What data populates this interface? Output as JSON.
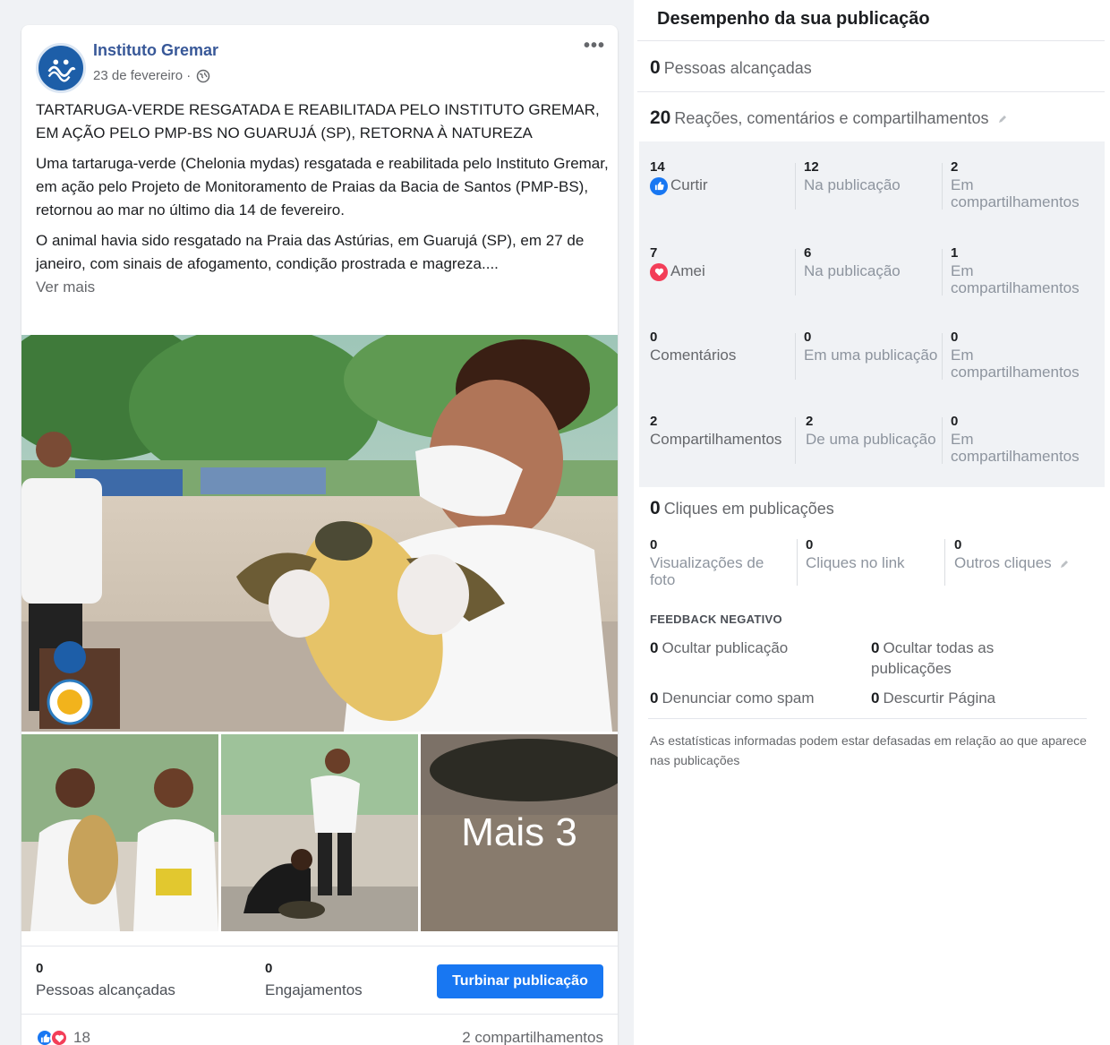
{
  "post": {
    "page_name": "Instituto Gremar",
    "date": "23 de fevereiro ·",
    "more": "•••",
    "title": "TARTARUGA-VERDE RESGATADA E REABILITADA PELO INSTITUTO GREMAR, EM AÇÃO PELO PMP-BS NO GUARUJÁ (SP), RETORNA À NATUREZA",
    "paragraph1": "Uma tartaruga-verde (Chelonia mydas) resgatada e reabilitada pelo Instituto Gremar, em ação pelo Projeto de Monitoramento de Praias da Bacia de Santos (PMP-BS), retornou ao mar no último dia 14 de fevereiro.",
    "paragraph2": "O animal havia sido resgatado na Praia das Astúrias, em Guarujá (SP), em 27 de janeiro, com sinais de afogamento, condição prostrada e magreza....",
    "see_more": "Ver mais",
    "more_photos": "Mais 3",
    "stats": {
      "reached_value": "0",
      "reached_label": "Pessoas alcançadas",
      "engagement_value": "0",
      "engagement_label": "Engajamentos",
      "boost_label": "Turbinar publicação"
    },
    "footer": {
      "reactions_count": "18",
      "shares": "2 compartilhamentos"
    }
  },
  "insights": {
    "title": "Desempenho da sua publicação",
    "reached_value": "0",
    "reached_label": "Pessoas alcançadas",
    "interactions_value": "20",
    "interactions_label": "Reações, comentários e compartilhamentos",
    "rows": [
      {
        "c1_num": "14",
        "c1_lbl": "Curtir",
        "c2_num": "12",
        "c2_lbl": "Na publicação",
        "c3_num": "2",
        "c3_lbl": "Em compartilhamentos"
      },
      {
        "c1_num": "7",
        "c1_lbl": "Amei",
        "c2_num": "6",
        "c2_lbl": "Na publicação",
        "c3_num": "1",
        "c3_lbl": "Em compartilhamentos"
      },
      {
        "c1_num": "0",
        "c1_lbl": "Comentários",
        "c2_num": "0",
        "c2_lbl": "Em uma publicação",
        "c3_num": "0",
        "c3_lbl": "Em compartilhamentos"
      },
      {
        "c1_num": "2",
        "c1_lbl": "Compartilhamentos",
        "c2_num": "2",
        "c2_lbl": "De uma publicação",
        "c3_num": "0",
        "c3_lbl": "Em compartilhamentos"
      }
    ],
    "clicks_value": "0",
    "clicks_label": "Cliques em publicações",
    "clicks": [
      {
        "num": "0",
        "lbl": "Visualizações de foto"
      },
      {
        "num": "0",
        "lbl": "Cliques no link"
      },
      {
        "num": "0",
        "lbl": "Outros cliques"
      }
    ],
    "negative_title": "FEEDBACK NEGATIVO",
    "negative": [
      {
        "num": "0",
        "lbl": "Ocultar publicação"
      },
      {
        "num": "0",
        "lbl": "Ocultar todas as publicações"
      },
      {
        "num": "0",
        "lbl": "Denunciar como spam"
      },
      {
        "num": "0",
        "lbl": "Descurtir Página"
      }
    ],
    "disclaimer": "As estatísticas informadas podem estar defasadas em relação ao que aparece nas publicações"
  },
  "colors": {
    "accent": "#1877f2",
    "love": "#f33e58",
    "link": "#385898"
  }
}
